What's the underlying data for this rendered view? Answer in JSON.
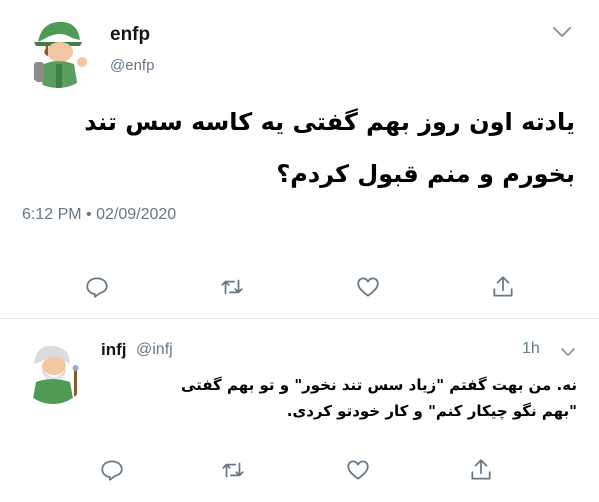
{
  "tweet1": {
    "name": "enfp",
    "handle": "@enfp",
    "text_line1": "یادته اون روز بهم گفتی یه کاسه سس تند",
    "text_line2": "بخورم و منم قبول کردم؟",
    "timestamp": "6:12 PM • 02/09/2020",
    "icons": {
      "reply": "reply-icon",
      "retweet": "retweet-icon",
      "like": "like-icon",
      "share": "share-icon",
      "caret": "chevron-down-icon"
    }
  },
  "tweet2": {
    "name": "infj",
    "handle": "@infj",
    "time": "1h",
    "text_line1": "نه. من بهت گفتم \"زیاد سس تند نخور\" و تو بهم گفتی",
    "text_line2": "\"بهم نگو چیکار کنم\" و کار خودتو کردی.",
    "icons": {
      "reply": "reply-icon",
      "retweet": "retweet-icon",
      "like": "like-icon",
      "share": "share-icon",
      "caret": "chevron-down-icon"
    }
  },
  "colors": {
    "secondary_text": "#657786",
    "icon_gray": "#657786",
    "divider": "#e1e8ed",
    "avatar_green": "#5a9e5e"
  }
}
